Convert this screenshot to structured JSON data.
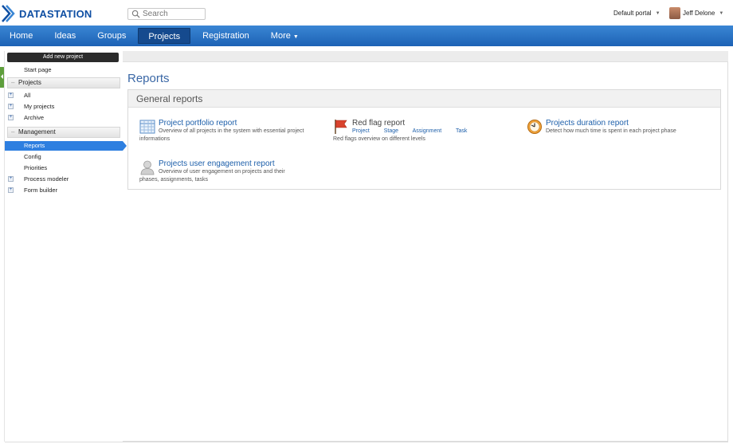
{
  "header": {
    "logo_text": "DATASTATION",
    "search_placeholder": "Search",
    "portal_label": "Default portal",
    "user_name": "Jeff Delone"
  },
  "nav": {
    "items": [
      {
        "label": "Home"
      },
      {
        "label": "Ideas"
      },
      {
        "label": "Groups"
      },
      {
        "label": "Projects"
      },
      {
        "label": "Registration"
      },
      {
        "label": "More"
      }
    ],
    "active": "Projects"
  },
  "sidebar": {
    "add_button": "Add new project",
    "start_page": "Start page",
    "sections": [
      {
        "title": "Projects",
        "items": [
          {
            "label": "All"
          },
          {
            "label": "My projects"
          },
          {
            "label": "Archive"
          }
        ]
      },
      {
        "title": "Management",
        "items": [
          {
            "label": "Reports"
          },
          {
            "label": "Config"
          },
          {
            "label": "Priorities"
          },
          {
            "label": "Process modeler"
          },
          {
            "label": "Form builder"
          }
        ]
      }
    ],
    "active_item": "Reports"
  },
  "main": {
    "title": "Reports",
    "panel_title": "General reports",
    "reports": [
      {
        "title": "Project portfolio report",
        "desc_line1": "Overview of all projects in the system with essential project",
        "desc_line2": "informations",
        "icon": "table-icon"
      },
      {
        "title": "Red flag report",
        "links": [
          "Project",
          "Stage",
          "Assignment",
          "Task"
        ],
        "desc_line1": "Red flags overview on different levels",
        "icon": "red-flag-icon"
      },
      {
        "title": "Projects duration report",
        "desc_line1": "Detect how much time is spent in each project phase",
        "icon": "clock-icon"
      },
      {
        "title": "Projects user engagement report",
        "desc_line1": "Overview of user engagement on projects and their",
        "desc_line2": "phases, assignments, tasks",
        "icon": "user-icon"
      }
    ]
  },
  "colors": {
    "nav_blue": "#1d62b5",
    "link_blue": "#1d5faa",
    "active_blue": "#2e7fe0",
    "sidebar_tab_green": "#5e9e3c"
  }
}
